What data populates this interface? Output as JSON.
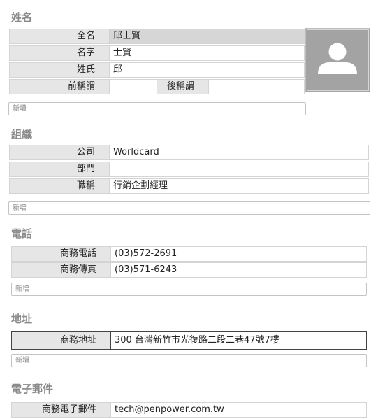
{
  "name_section": {
    "title": "姓名",
    "rows": {
      "full_name": {
        "label": "全名",
        "value": "邱士賢"
      },
      "first_name": {
        "label": "名字",
        "value": "士賢"
      },
      "last_name": {
        "label": "姓氏",
        "value": "邱"
      },
      "prefix": {
        "label": "前稱謂",
        "value": ""
      },
      "suffix": {
        "label": "後稱謂",
        "value": ""
      }
    },
    "add_label": "新增"
  },
  "org_section": {
    "title": "組織",
    "rows": {
      "company": {
        "label": "公司",
        "value": "Worldcard"
      },
      "department": {
        "label": "部門",
        "value": ""
      },
      "job_title": {
        "label": "職稱",
        "value": "行銷企劃經理"
      }
    },
    "add_label": "新增"
  },
  "phone_section": {
    "title": "電話",
    "rows": {
      "work_phone": {
        "label": "商務電話",
        "value": "(03)572-2691"
      },
      "work_fax": {
        "label": "商務傳真",
        "value": "(03)571-6243"
      }
    },
    "add_label": "新增"
  },
  "address_section": {
    "title": "地址",
    "rows": {
      "work_address": {
        "label": "商務地址",
        "value": "300 台灣新竹市光復路二段二巷47號7樓"
      }
    },
    "add_label": "新增"
  },
  "email_section": {
    "title": "電子郵件",
    "rows": {
      "work_email": {
        "label": "商務電子郵件",
        "value": "tech@penpower.com.tw"
      }
    }
  },
  "photo": {
    "icon": "person-silhouette-icon"
  }
}
